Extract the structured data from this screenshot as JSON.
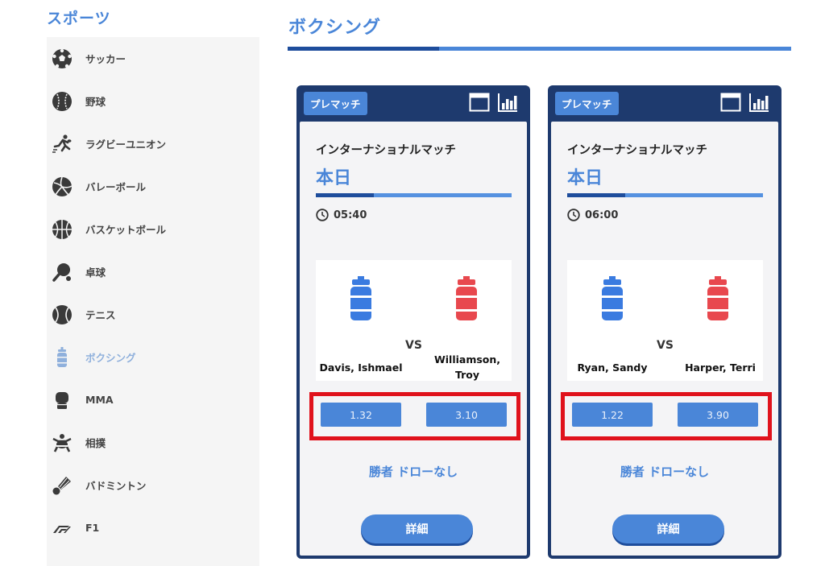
{
  "sidebar": {
    "title": "スポーツ",
    "items": [
      {
        "label": "サッカー",
        "icon": "soccer-ball-icon"
      },
      {
        "label": "野球",
        "icon": "baseball-icon"
      },
      {
        "label": "ラグビーユニオン",
        "icon": "rugby-player-icon"
      },
      {
        "label": "バレーボール",
        "icon": "volleyball-icon"
      },
      {
        "label": "バスケットボール",
        "icon": "basketball-icon"
      },
      {
        "label": "卓球",
        "icon": "table-tennis-icon"
      },
      {
        "label": "テニス",
        "icon": "tennis-ball-icon"
      },
      {
        "label": "ボクシング",
        "icon": "punching-bag-icon",
        "active": true
      },
      {
        "label": "MMA",
        "icon": "mma-glove-icon"
      },
      {
        "label": "相撲",
        "icon": "sumo-icon"
      },
      {
        "label": "バドミントン",
        "icon": "shuttlecock-icon"
      },
      {
        "label": "F1",
        "icon": "f1-logo-icon"
      }
    ]
  },
  "main": {
    "title": "ボクシング",
    "cards": [
      {
        "badge": "プレマッチ",
        "league": "インターナショナルマッチ",
        "date": "本日",
        "time": "05:40",
        "vs": "VS",
        "home": "Davis, Ishmael",
        "away": "Williamson, Troy",
        "odds_home": "1.32",
        "odds_away": "3.10",
        "market": "勝者 ドローなし",
        "detail": "詳細"
      },
      {
        "badge": "プレマッチ",
        "league": "インターナショナルマッチ",
        "date": "本日",
        "time": "06:00",
        "vs": "VS",
        "home": "Ryan, Sandy",
        "away": "Harper, Terri",
        "odds_home": "1.22",
        "odds_away": "3.90",
        "market": "勝者 ドローなし",
        "detail": "詳細"
      }
    ]
  },
  "colors": {
    "accent": "#4a86d8",
    "navy": "#1e3a6e",
    "home_corner": "#3a7be0",
    "away_corner": "#e8484e",
    "highlight": "#e0121c"
  }
}
